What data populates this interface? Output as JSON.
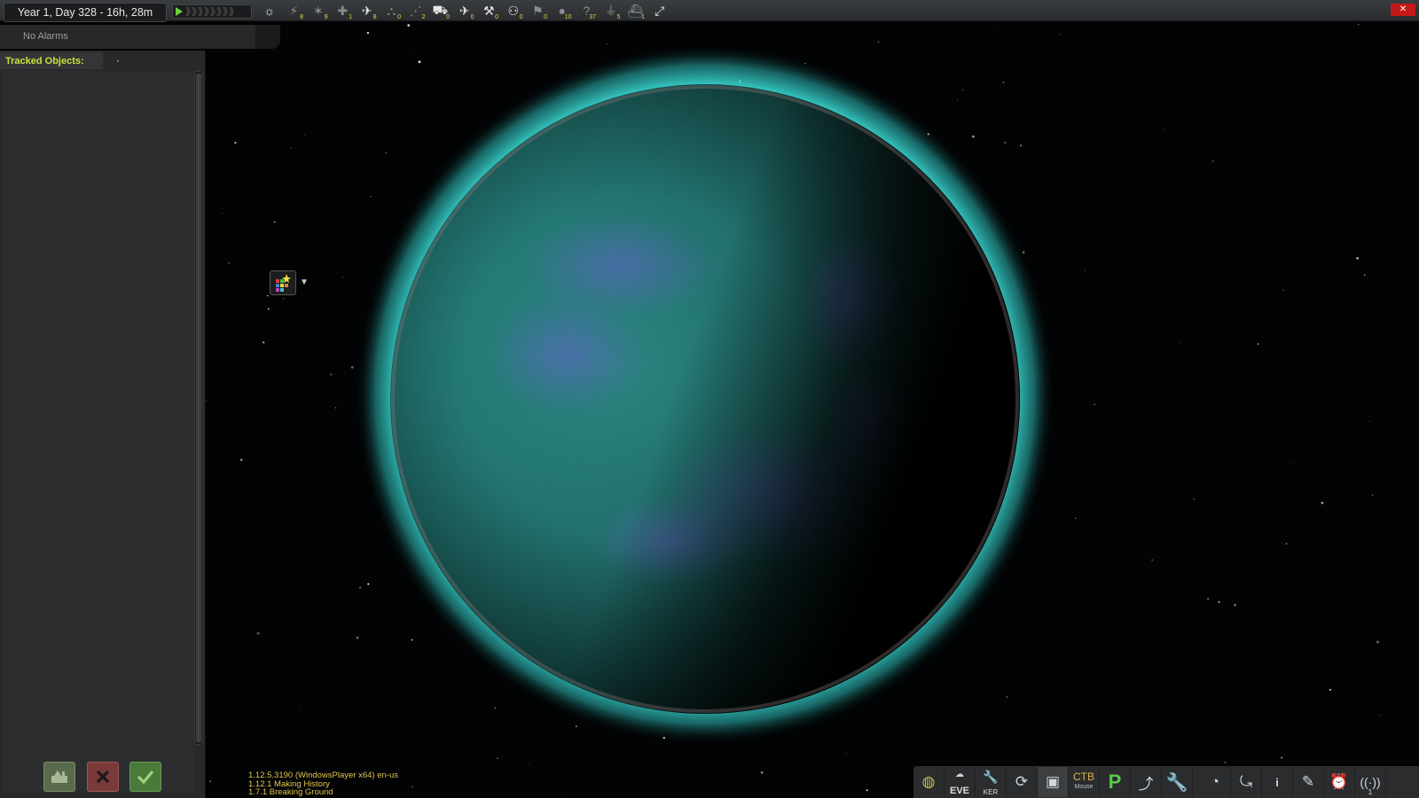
{
  "date_display": "Year 1, Day 328 - 16h, 28m",
  "alarms": {
    "label": "No Alarms"
  },
  "tracked_objects": {
    "label": "Tracked Objects:"
  },
  "filters": [
    {
      "name": "sun-icon",
      "glyph": "☼",
      "count": "",
      "on": true
    },
    {
      "name": "debris-icon",
      "glyph": "⚡",
      "count": "8",
      "on": false
    },
    {
      "name": "probe-icon",
      "glyph": "✶",
      "count": "9",
      "on": false
    },
    {
      "name": "relay-icon",
      "glyph": "✚",
      "count": "1",
      "on": false
    },
    {
      "name": "rover-lander-icon",
      "glyph": "✈",
      "count": "8",
      "on": true
    },
    {
      "name": "ship-icon",
      "glyph": "⛬",
      "count": "0",
      "on": false
    },
    {
      "name": "station-icon",
      "glyph": "⋰",
      "count": "2",
      "on": false
    },
    {
      "name": "base-icon",
      "glyph": "⛟",
      "count": "0",
      "on": true
    },
    {
      "name": "plane-icon",
      "glyph": "✈",
      "count": "0",
      "on": true
    },
    {
      "name": "satellite-icon",
      "glyph": "⚒",
      "count": "0",
      "on": true
    },
    {
      "name": "eva-icon",
      "glyph": "⚇",
      "count": "0",
      "on": true
    },
    {
      "name": "flag-icon",
      "glyph": "⚑",
      "count": "0",
      "on": false
    },
    {
      "name": "asteroid-icon",
      "glyph": "●",
      "count": "10",
      "on": false
    },
    {
      "name": "unknown-icon",
      "glyph": "?",
      "count": "37",
      "on": false
    },
    {
      "name": "ground-science-icon",
      "glyph": "⏚",
      "count": "5",
      "on": false
    },
    {
      "name": "deployed-icon",
      "glyph": "⛴",
      "count": "1",
      "on": false
    },
    {
      "name": "expand-icon",
      "glyph": "⤢",
      "count": "",
      "on": true
    }
  ],
  "version": {
    "line1": "1.12.5.3190 (WindowsPlayer x64) en-us",
    "line2": "1.12.1 Making History",
    "line3": "1.7.1 Breaking Ground"
  },
  "toolbar": {
    "eve_label": "EVE",
    "ker_label": "KER",
    "ctb_label": "CTB",
    "ctb_sub": "Mouse",
    "p_label": "P",
    "info_label": "i",
    "antenna_count": "1"
  },
  "colors": {
    "atmosphere": "#3fe6df",
    "planet": "#2a8f8a",
    "accent_green": "#c8e03a",
    "version_text": "#e2c54a"
  }
}
